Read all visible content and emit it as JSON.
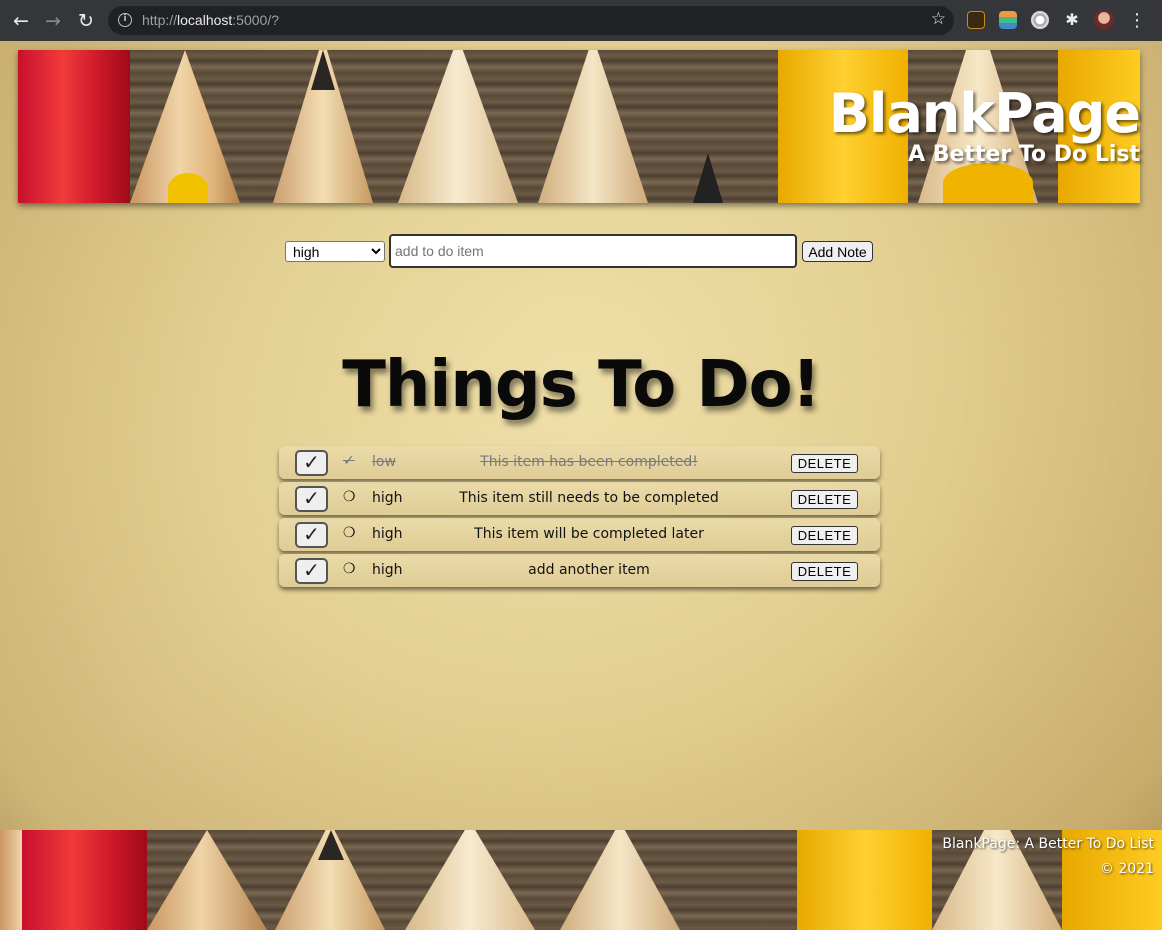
{
  "browser": {
    "url_prefix": "http://",
    "url_host": "localhost",
    "url_rest": ":5000/?",
    "back_icon": "←",
    "forward_icon": "→",
    "reload_icon": "↻",
    "star_icon": "☆"
  },
  "header": {
    "title": "BlankPage",
    "subtitle": "A Better To Do List"
  },
  "form": {
    "priority_selected": "high",
    "priority_options": [
      "high"
    ],
    "input_placeholder": "add to do item",
    "input_value": "",
    "add_button_label": "Add Note"
  },
  "main": {
    "heading": "Things To Do!"
  },
  "todos": [
    {
      "check": "✓",
      "status_mark": "✓",
      "priority": "low",
      "text": "This item has been completed!",
      "delete_label": "DELETE",
      "completed": true
    },
    {
      "check": "✓",
      "status_mark": "❍",
      "priority": "high",
      "text": "This item still needs to be completed",
      "delete_label": "DELETE",
      "completed": false
    },
    {
      "check": "✓",
      "status_mark": "❍",
      "priority": "high",
      "text": "This item will be completed later",
      "delete_label": "DELETE",
      "completed": false
    },
    {
      "check": "✓",
      "status_mark": "❍",
      "priority": "high",
      "text": "add another item",
      "delete_label": "DELETE",
      "completed": false
    }
  ],
  "footer": {
    "line1": "BlankPage: A Better To Do List",
    "line2": "© 2021"
  },
  "colors": {
    "completed_text": "#777a80",
    "heading": "#0a0a0a",
    "banner_text": "#ffffff"
  }
}
